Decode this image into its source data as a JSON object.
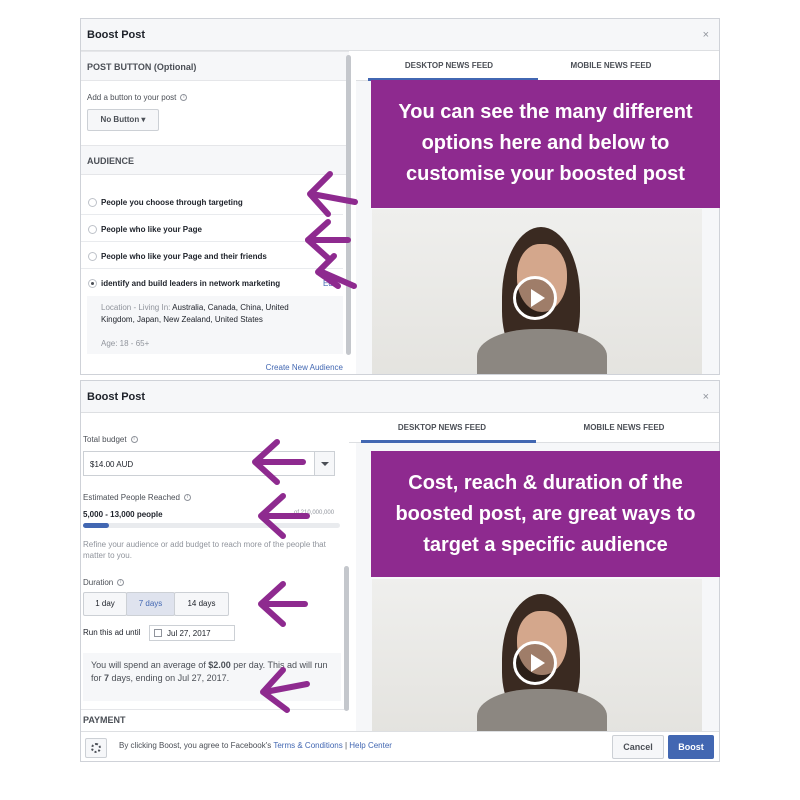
{
  "top_panel": {
    "dialog_title": "Boost Post",
    "close_glyph": "×",
    "post_button_section": "POST BUTTON (Optional)",
    "add_button_label": "Add a button to your post",
    "button_select_value": "No Button ▾",
    "audience_section": "AUDIENCE",
    "audience_options": [
      {
        "label": "People you choose through targeting",
        "selected": false
      },
      {
        "label": "People who like your Page",
        "selected": false
      },
      {
        "label": "People who like your Page and their friends",
        "selected": false
      },
      {
        "label": "identify and build leaders in network marketing",
        "selected": true
      }
    ],
    "edit_link": "Edit",
    "location_label": "Location - Living In: ",
    "location_value": "Australia, Canada, China, United Kingdom, Japan, New Zealand, United States",
    "age_text": "Age: 18 - 65+",
    "create_audience_link": "Create New Audience",
    "tabs": [
      "DESKTOP NEWS FEED",
      "MOBILE NEWS FEED"
    ],
    "callout": "You can see the many different options here and below to customise your boosted post"
  },
  "bottom_panel": {
    "dialog_title": "Boost Post",
    "close_glyph": "×",
    "total_budget_label": "Total budget",
    "budget_value": "$14.00 AUD",
    "estimated_reach_label": "Estimated People Reached",
    "reach_range": "5,000 - 13,000 people",
    "reach_total": "of 210,000,000",
    "reach_fill_fraction": 0.1,
    "refine_text": "Refine your audience or add budget to reach more of the people that matter to you.",
    "duration_label": "Duration",
    "duration_options": [
      {
        "label": "1 day",
        "selected": false
      },
      {
        "label": "7 days",
        "selected": true
      },
      {
        "label": "14 days",
        "selected": false
      }
    ],
    "run_until_label": "Run this ad until",
    "run_until_date": "Jul 27, 2017",
    "summary_prefix": "You will spend an average of ",
    "summary_amount": "$2.00",
    "summary_mid": " per day. This ad will run for ",
    "summary_days": "7",
    "summary_suffix": " days, ending on Jul 27, 2017.",
    "payment_section": "PAYMENT",
    "footer_text": "By clicking Boost, you agree to Facebook's ",
    "terms_link": "Terms & Conditions",
    "separator": "|",
    "help_link": "Help Center",
    "cancel_button": "Cancel",
    "boost_button": "Boost",
    "tabs": [
      "DESKTOP NEWS FEED",
      "MOBILE NEWS FEED"
    ],
    "callout": "Cost, reach & duration of the boosted post, are great ways to target a specific audience"
  },
  "colors": {
    "callout_purple": "#8e2a8f",
    "arrow_purple": "#8e2a8f",
    "facebook_blue": "#4267b2"
  },
  "icons": [
    "info-icon",
    "close-icon",
    "play-icon",
    "calendar-icon",
    "gear-icon",
    "chevron-down-icon",
    "arrow-left-icon"
  ]
}
